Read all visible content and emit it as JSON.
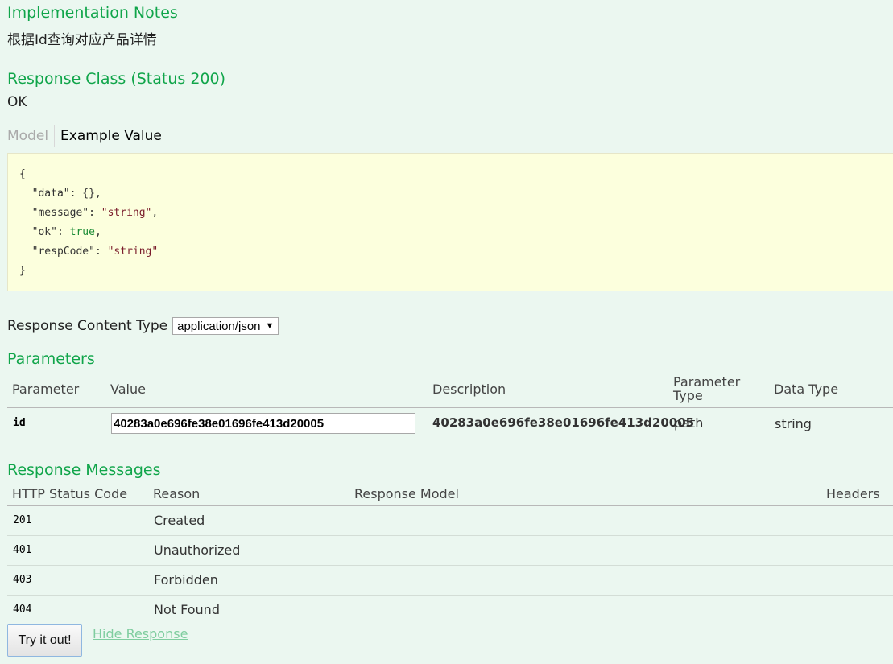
{
  "implementation": {
    "title": "Implementation Notes",
    "text": "根据Id查询对应产品详情"
  },
  "response_class": {
    "title": "Response Class (Status 200)",
    "text": "OK"
  },
  "tabs": {
    "model": "Model",
    "example": "Example Value"
  },
  "example_json": {
    "open": "{",
    "close": "}",
    "rows": [
      {
        "key": "\"data\"",
        "value": "{}",
        "type": "plain",
        "sep": ","
      },
      {
        "key": "\"message\"",
        "value": "\"string\"",
        "type": "string",
        "sep": ","
      },
      {
        "key": "\"ok\"",
        "value": "true",
        "type": "bool",
        "sep": ","
      },
      {
        "key": "\"respCode\"",
        "value": "\"string\"",
        "type": "string",
        "sep": ""
      }
    ]
  },
  "content_type": {
    "label": "Response Content Type",
    "selected": "application/json"
  },
  "parameters": {
    "title": "Parameters",
    "headers": {
      "parameter": "Parameter",
      "value": "Value",
      "description": "Description",
      "param_type_line1": "Parameter",
      "param_type_line2": "Type",
      "data_type": "Data Type"
    },
    "row": {
      "name": "id",
      "value": "40283a0e696fe38e01696fe413d20005",
      "description": "40283a0e696fe38e01696fe413d20005",
      "param_type": "path",
      "data_type": "string"
    }
  },
  "responses": {
    "title": "Response Messages",
    "headers": {
      "code": "HTTP Status Code",
      "reason": "Reason",
      "model": "Response Model",
      "headers": "Headers"
    },
    "rows": [
      {
        "code": "201",
        "reason": "Created"
      },
      {
        "code": "401",
        "reason": "Unauthorized"
      },
      {
        "code": "403",
        "reason": "Forbidden"
      },
      {
        "code": "404",
        "reason": "Not Found"
      }
    ]
  },
  "actions": {
    "try_label": "Try it out!",
    "hide_label": "Hide Response"
  }
}
